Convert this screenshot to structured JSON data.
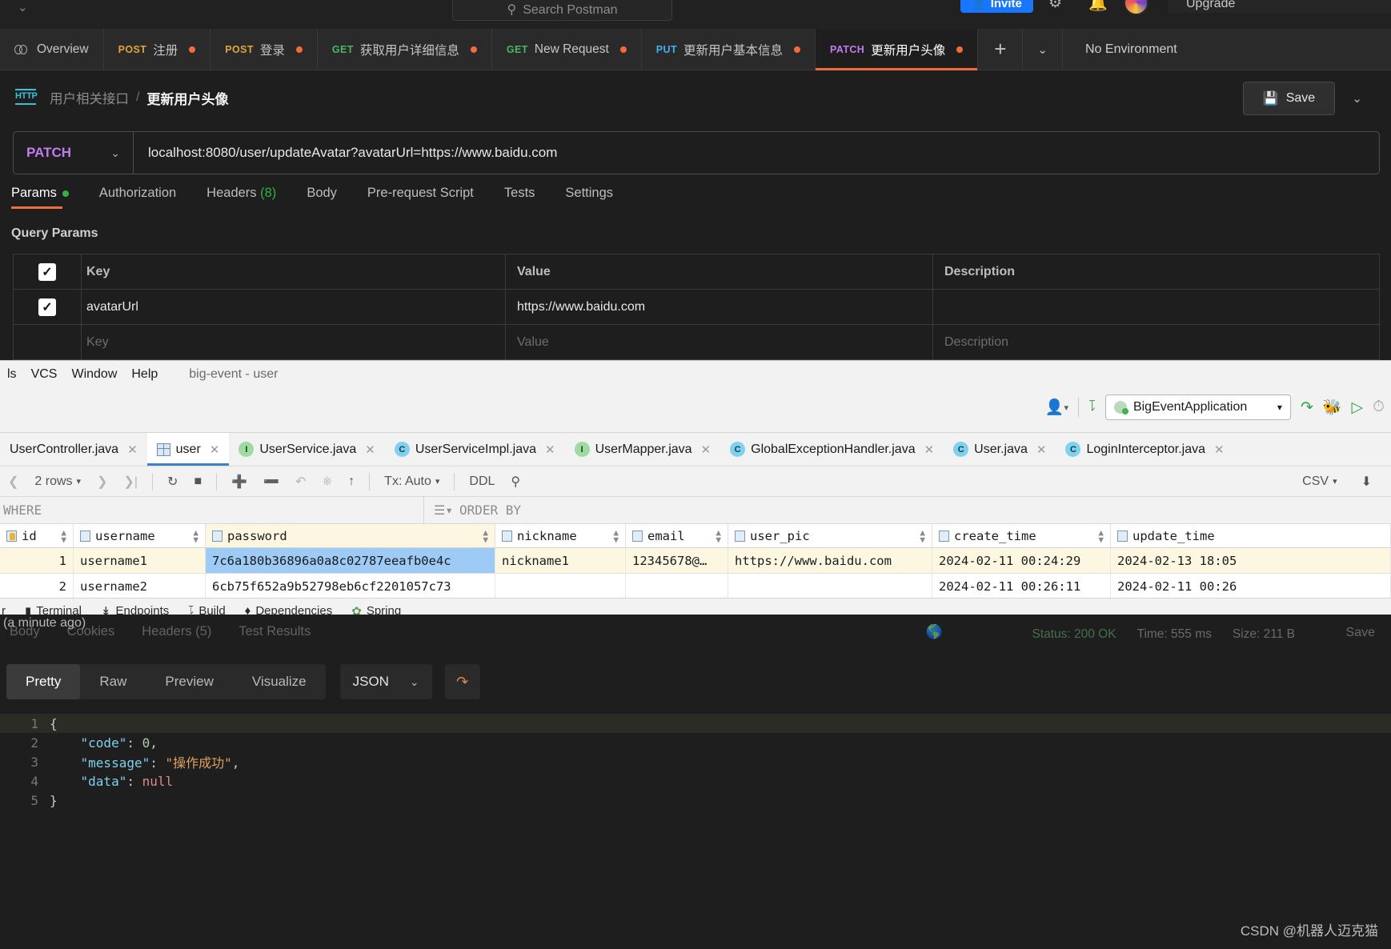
{
  "postman": {
    "search_placeholder": "Search Postman",
    "invite_label": "Invite",
    "upgrade_label": "Upgrade",
    "environment_label": "No Environment",
    "tabs": [
      {
        "verb": "",
        "label": "Overview",
        "dirty": false,
        "active": false
      },
      {
        "verb": "POST",
        "label": "注册",
        "dirty": true,
        "active": false
      },
      {
        "verb": "POST",
        "label": "登录",
        "dirty": true,
        "active": false
      },
      {
        "verb": "GET",
        "label": "获取用户详细信息",
        "dirty": true,
        "active": false
      },
      {
        "verb": "GET",
        "label": "New Request",
        "dirty": true,
        "active": false
      },
      {
        "verb": "PUT",
        "label": "更新用户基本信息",
        "dirty": true,
        "active": false
      },
      {
        "verb": "PATCH",
        "label": "更新用户头像",
        "dirty": true,
        "active": true
      }
    ],
    "add_tab_label": "+",
    "tab_list_caret": "⌄",
    "breadcrumb": {
      "http_badge": "HTTP",
      "parent": "用户相关接口",
      "separator": "/",
      "current": "更新用户头像"
    },
    "save_label": "Save",
    "request": {
      "method": "PATCH",
      "url": "localhost:8080/user/updateAvatar?avatarUrl=https://www.baidu.com"
    },
    "request_tabs": [
      {
        "label": "Params",
        "badge": "dot",
        "active": true
      },
      {
        "label": "Authorization",
        "badge": "",
        "active": false
      },
      {
        "label": "Headers",
        "badge": "(8)",
        "active": false
      },
      {
        "label": "Body",
        "badge": "",
        "active": false
      },
      {
        "label": "Pre-request Script",
        "badge": "",
        "active": false
      },
      {
        "label": "Tests",
        "badge": "",
        "active": false
      },
      {
        "label": "Settings",
        "badge": "",
        "active": false
      }
    ],
    "query_params": {
      "title": "Query Params",
      "headers": [
        "Key",
        "Value",
        "Description"
      ],
      "rows": [
        {
          "checked": true,
          "key": "avatarUrl",
          "value": "https://www.baidu.com",
          "description": ""
        }
      ],
      "placeholder_row": {
        "key": "Key",
        "value": "Value",
        "description": "Description"
      }
    },
    "response": {
      "time_ago": "(a minute ago)",
      "tabs": [
        "Body",
        "Cookies",
        "Headers (5)",
        "Test Results"
      ],
      "status_text": "Status: 200 OK",
      "time_text": "Time: 555 ms",
      "size_text": "Size: 211 B",
      "save_response_label": "Save",
      "format_tabs": [
        "Pretty",
        "Raw",
        "Preview",
        "Visualize"
      ],
      "format_active": "Pretty",
      "language": "JSON",
      "body_lines": [
        {
          "n": "1",
          "text": "{"
        },
        {
          "n": "2",
          "text": "    \"code\": 0,"
        },
        {
          "n": "3",
          "text": "    \"message\": \"操作成功\","
        },
        {
          "n": "4",
          "text": "    \"data\": null"
        },
        {
          "n": "5",
          "text": "}"
        }
      ]
    }
  },
  "ide": {
    "menu": [
      "ls",
      "VCS",
      "Window",
      "Help"
    ],
    "project_label": "big-event - user",
    "run_config": "BigEventApplication",
    "file_tabs": [
      {
        "label": "UserController.java",
        "icon": "c-class-icon",
        "selected": false
      },
      {
        "label": "user",
        "icon": "table-icon",
        "selected": true
      },
      {
        "label": "UserService.java",
        "icon": "i-interface-icon",
        "selected": false
      },
      {
        "label": "UserServiceImpl.java",
        "icon": "c-class-icon",
        "selected": false
      },
      {
        "label": "UserMapper.java",
        "icon": "i-interface-icon",
        "selected": false
      },
      {
        "label": "GlobalExceptionHandler.java",
        "icon": "c-class-icon",
        "selected": false
      },
      {
        "label": "User.java",
        "icon": "c-class-icon",
        "selected": false
      },
      {
        "label": "LoginInterceptor.java",
        "icon": "c-class-icon",
        "selected": false
      }
    ],
    "grid_toolbar": {
      "rows_label": "2 rows",
      "tx_label": "Tx: Auto",
      "ddl_label": "DDL",
      "export_label": "CSV"
    },
    "where_label": "WHERE",
    "order_by_label": "ORDER BY",
    "table": {
      "columns": [
        "id",
        "username",
        "password",
        "nickname",
        "email",
        "user_pic",
        "create_time",
        "update_time"
      ],
      "highlighted_column": "password",
      "rows": [
        {
          "id": "1",
          "username": "username1",
          "password": "7c6a180b36896a0a8c02787eeafb0e4c",
          "nickname": "nickname1",
          "email": "12345678@…",
          "user_pic": "https://www.baidu.com",
          "create_time": "2024-02-11 00:24:29",
          "update_time": "2024-02-13 18:05",
          "selected_cell": "password"
        },
        {
          "id": "2",
          "username": "username2",
          "password": "6cb75f652a9b52798eb6cf2201057c73",
          "nickname": "",
          "email": "",
          "user_pic": "",
          "create_time": "2024-02-11 00:26:11",
          "update_time": "2024-02-11 00:26",
          "selected_cell": ""
        }
      ]
    },
    "bottom_bar": [
      "Terminal",
      "Endpoints",
      "Build",
      "Dependencies",
      "Spring"
    ]
  },
  "watermark": "CSDN @机器人迈克猫"
}
